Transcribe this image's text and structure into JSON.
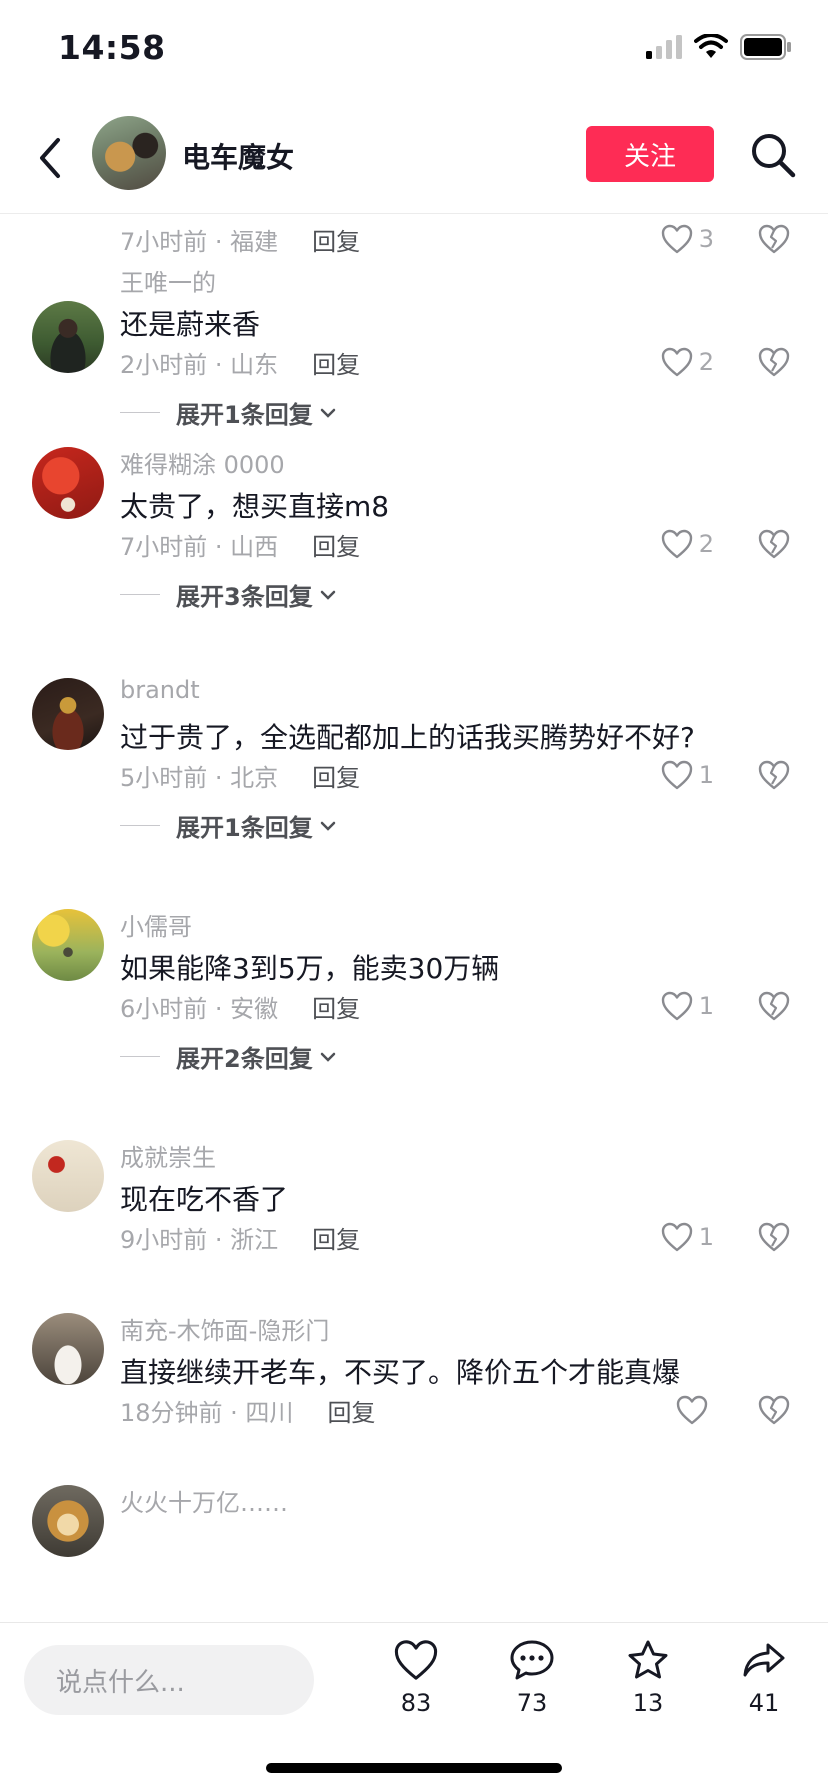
{
  "status": {
    "time": "14:58"
  },
  "header": {
    "title": "电车魔女",
    "follow_label": "关注"
  },
  "partial_top": {
    "meta": "7小时前 · 福建",
    "reply": "回复",
    "likes": "3"
  },
  "comments": [
    {
      "user": "王唯一的",
      "text": "还是蔚来香",
      "meta": "2小时前 · 山东",
      "reply": "回复",
      "likes": "2",
      "expand": "展开1条回复"
    },
    {
      "user": "难得糊涂 0000",
      "text": "太贵了，想买直接m8",
      "meta": "7小时前 · 山西",
      "reply": "回复",
      "likes": "2",
      "expand": "展开3条回复"
    },
    {
      "user": "brandt",
      "text": "过于贵了，全选配都加上的话我买腾势好不好?",
      "meta": "5小时前 · 北京",
      "reply": "回复",
      "likes": "1",
      "expand": "展开1条回复"
    },
    {
      "user": "小儒哥",
      "text": "如果能降3到5万，能卖30万辆",
      "meta": "6小时前 · 安徽",
      "reply": "回复",
      "likes": "1",
      "expand": "展开2条回复"
    },
    {
      "user": "成就崇生",
      "text": "现在吃不香了",
      "meta": "9小时前 · 浙江",
      "reply": "回复",
      "likes": "1",
      "expand": ""
    },
    {
      "user": "南充-木饰面-隐形门",
      "text": "直接继续开老车，不买了。降价五个才能真爆",
      "meta": "18分钟前 · 四川",
      "reply": "回复",
      "likes": "",
      "expand": ""
    },
    {
      "user": "火火十万亿……",
      "text": "",
      "meta": "",
      "reply": "",
      "likes": "",
      "expand": ""
    }
  ],
  "bottom": {
    "input_placeholder": "说点什么...",
    "like_count": "83",
    "comment_count": "73",
    "star_count": "13",
    "share_count": "41"
  },
  "colors": {
    "accent": "#fe2c55",
    "text": "#161823",
    "muted": "#a6a7ab"
  },
  "icons": [
    "back-icon",
    "search-icon",
    "heart-icon",
    "dislike-icon",
    "chevron-down-icon",
    "comment-icon",
    "star-icon",
    "share-icon",
    "wifi-icon",
    "battery-icon",
    "signal-icon"
  ]
}
